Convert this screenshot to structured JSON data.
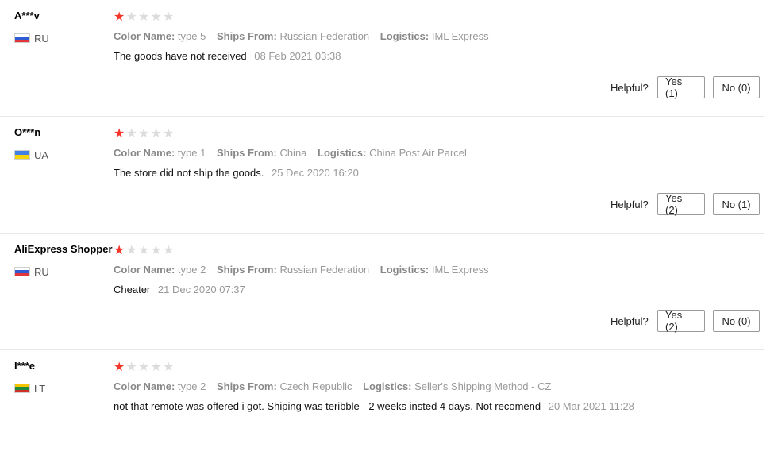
{
  "helpful_label": "Helpful?",
  "reviews": [
    {
      "user": "A***v",
      "country": "RU",
      "flag": [
        "#ffffff",
        "#2f5bd3",
        "#e2353a"
      ],
      "rating": 1,
      "color_name_label": "Color Name:",
      "color_name": "type 5",
      "ships_from_label": "Ships From:",
      "ships_from": "Russian Federation",
      "logistics_label": "Logistics:",
      "logistics": "IML Express",
      "text": "The goods have not received",
      "date": "08 Feb 2021 03:38",
      "yes": "Yes (1)",
      "no": "No (0)"
    },
    {
      "user": "O***n",
      "country": "UA",
      "flag": [
        "#3f7fe6",
        "#f5d40c"
      ],
      "rating": 1,
      "color_name_label": "Color Name:",
      "color_name": "type 1",
      "ships_from_label": "Ships From:",
      "ships_from": "China",
      "logistics_label": "Logistics:",
      "logistics": "China Post Air Parcel",
      "text": "The store did not ship the goods.",
      "date": "25 Dec 2020 16:20",
      "yes": "Yes (2)",
      "no": "No (1)"
    },
    {
      "user": "AliExpress Shopper",
      "country": "RU",
      "flag": [
        "#ffffff",
        "#2f5bd3",
        "#e2353a"
      ],
      "rating": 1,
      "color_name_label": "Color Name:",
      "color_name": "type 2",
      "ships_from_label": "Ships From:",
      "ships_from": "Russian Federation",
      "logistics_label": "Logistics:",
      "logistics": "IML Express",
      "text": "Cheater",
      "date": "21 Dec 2020 07:37",
      "yes": "Yes (2)",
      "no": "No (0)"
    },
    {
      "user": "I***e",
      "country": "LT",
      "flag": [
        "#f5c400",
        "#1f8a3c",
        "#d0302a"
      ],
      "rating": 1,
      "color_name_label": "Color Name:",
      "color_name": "type 2",
      "ships_from_label": "Ships From:",
      "ships_from": "Czech Republic",
      "logistics_label": "Logistics:",
      "logistics": "Seller's Shipping Method - CZ",
      "text": "not that remote was offered i got. Shiping was teribble - 2 weeks insted 4 days. Not recomend",
      "date": "20 Mar 2021 11:28",
      "yes": "",
      "no": ""
    }
  ]
}
